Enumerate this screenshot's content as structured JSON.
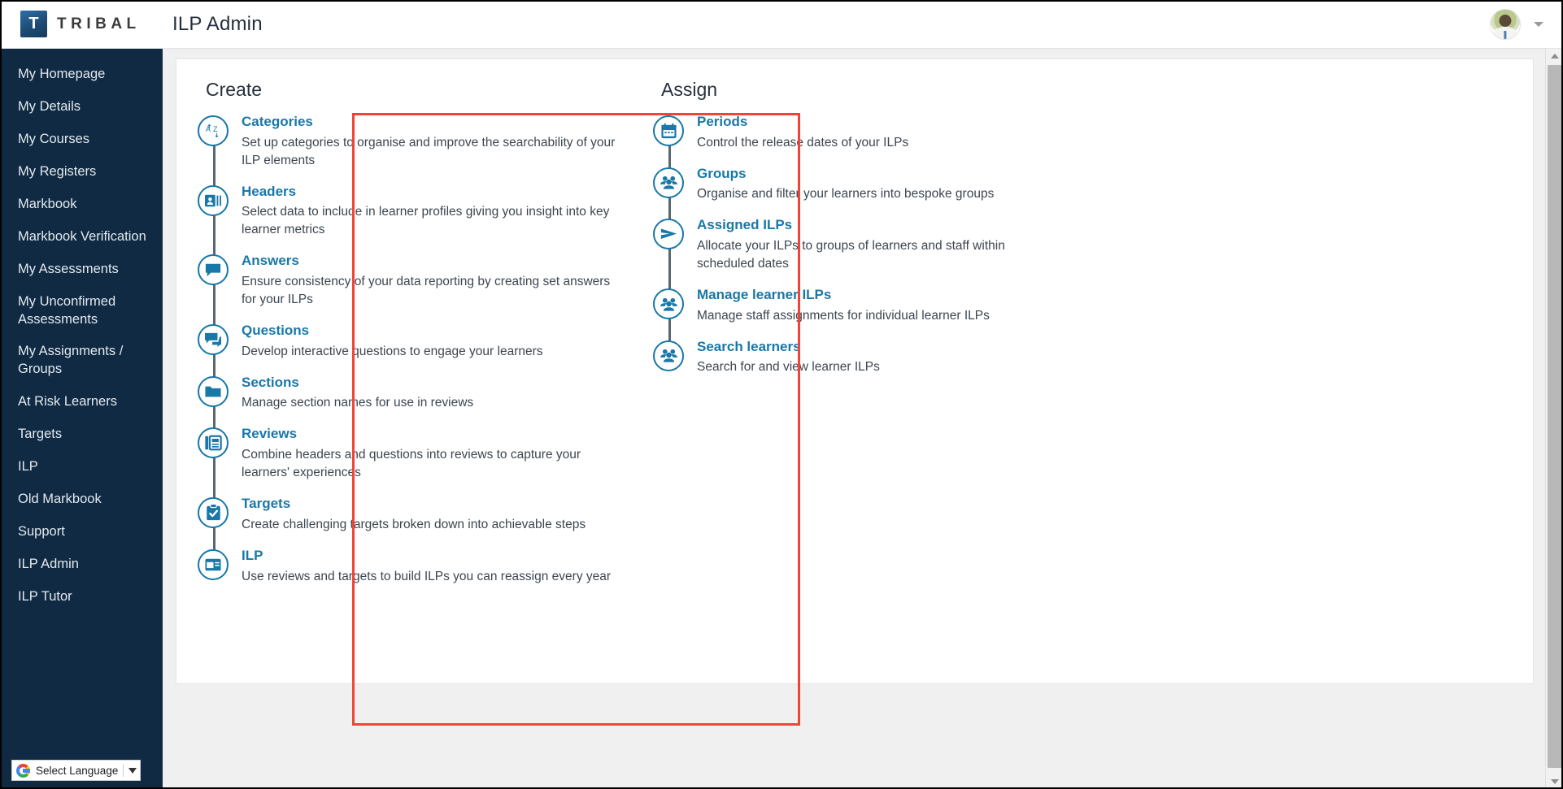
{
  "topbar": {
    "brand_mark": "T",
    "brand_name": "TRIBAL",
    "app_title": "ILP Admin",
    "avatar_name": "user-avatar",
    "caret_name": "chevron-down-icon"
  },
  "sidebar": {
    "items": [
      {
        "label": "My Homepage",
        "name": "my-homepage"
      },
      {
        "label": "My Details",
        "name": "my-details"
      },
      {
        "label": "My Courses",
        "name": "my-courses"
      },
      {
        "label": "My Registers",
        "name": "my-registers"
      },
      {
        "label": "Markbook",
        "name": "markbook"
      },
      {
        "label": "Markbook Verification",
        "name": "markbook-verification"
      },
      {
        "label": "My Assessments",
        "name": "my-assessments"
      },
      {
        "label": "My Unconfirmed\nAssessments",
        "name": "my-unconfirmed-assessments"
      },
      {
        "label": "My Assignments /\nGroups",
        "name": "my-assignments-groups"
      },
      {
        "label": "At Risk Learners",
        "name": "at-risk-learners"
      },
      {
        "label": "Targets",
        "name": "targets"
      },
      {
        "label": "ILP",
        "name": "ilp"
      },
      {
        "label": "Old Markbook",
        "name": "old-markbook"
      },
      {
        "label": "Support",
        "name": "support"
      },
      {
        "label": "ILP Admin",
        "name": "ilp-admin"
      },
      {
        "label": "ILP Tutor",
        "name": "ilp-tutor"
      }
    ],
    "language_widget": {
      "label": "Select Language",
      "logo_name": "google-logo-icon",
      "caret_name": "chevron-down-icon"
    }
  },
  "main": {
    "create": {
      "heading": "Create",
      "items": [
        {
          "title": "Categories",
          "desc": "Set up categories to organise and improve the searchability of your ILP elements",
          "icon": "az-sort-icon"
        },
        {
          "title": "Headers",
          "desc": "Select data to include in learner profiles giving you insight into key learner metrics",
          "icon": "id-card-icon"
        },
        {
          "title": "Answers",
          "desc": "Ensure consistency of your data reporting by creating set answers for your ILPs",
          "icon": "speech-bubble-icon"
        },
        {
          "title": "Questions",
          "desc": "Develop interactive questions to engage your learners",
          "icon": "chat-bubbles-icon"
        },
        {
          "title": "Sections",
          "desc": "Manage section names for use in reviews",
          "icon": "folder-icon"
        },
        {
          "title": "Reviews",
          "desc": "Combine headers and questions into reviews to capture your learners' experiences",
          "icon": "document-list-icon"
        },
        {
          "title": "Targets",
          "desc": "Create challenging targets broken down into achievable steps",
          "icon": "clipboard-check-icon"
        },
        {
          "title": "ILP",
          "desc": "Use reviews and targets to build ILPs you can reassign every year",
          "icon": "window-panel-icon"
        }
      ]
    },
    "assign": {
      "heading": "Assign",
      "items": [
        {
          "title": "Periods",
          "desc": "Control the release dates of your ILPs",
          "icon": "calendar-icon"
        },
        {
          "title": "Groups",
          "desc": "Organise and filter your learners into bespoke groups",
          "icon": "people-group-icon"
        },
        {
          "title": "Assigned ILPs",
          "desc": "Allocate your ILPs to groups of learners and staff within scheduled dates",
          "icon": "send-arrow-icon"
        },
        {
          "title": "Manage learner ILPs",
          "desc": "Manage staff assignments for individual learner ILPs",
          "icon": "people-group-icon"
        },
        {
          "title": "Search learners",
          "desc": "Search for and view learner ILPs",
          "icon": "people-group-icon"
        }
      ]
    }
  },
  "colors": {
    "sidebar_bg": "#102a43",
    "accent_link": "#1878a8",
    "highlight_border": "#f04438",
    "rail": "#5a6872",
    "content_bg": "#f0f0f0"
  }
}
